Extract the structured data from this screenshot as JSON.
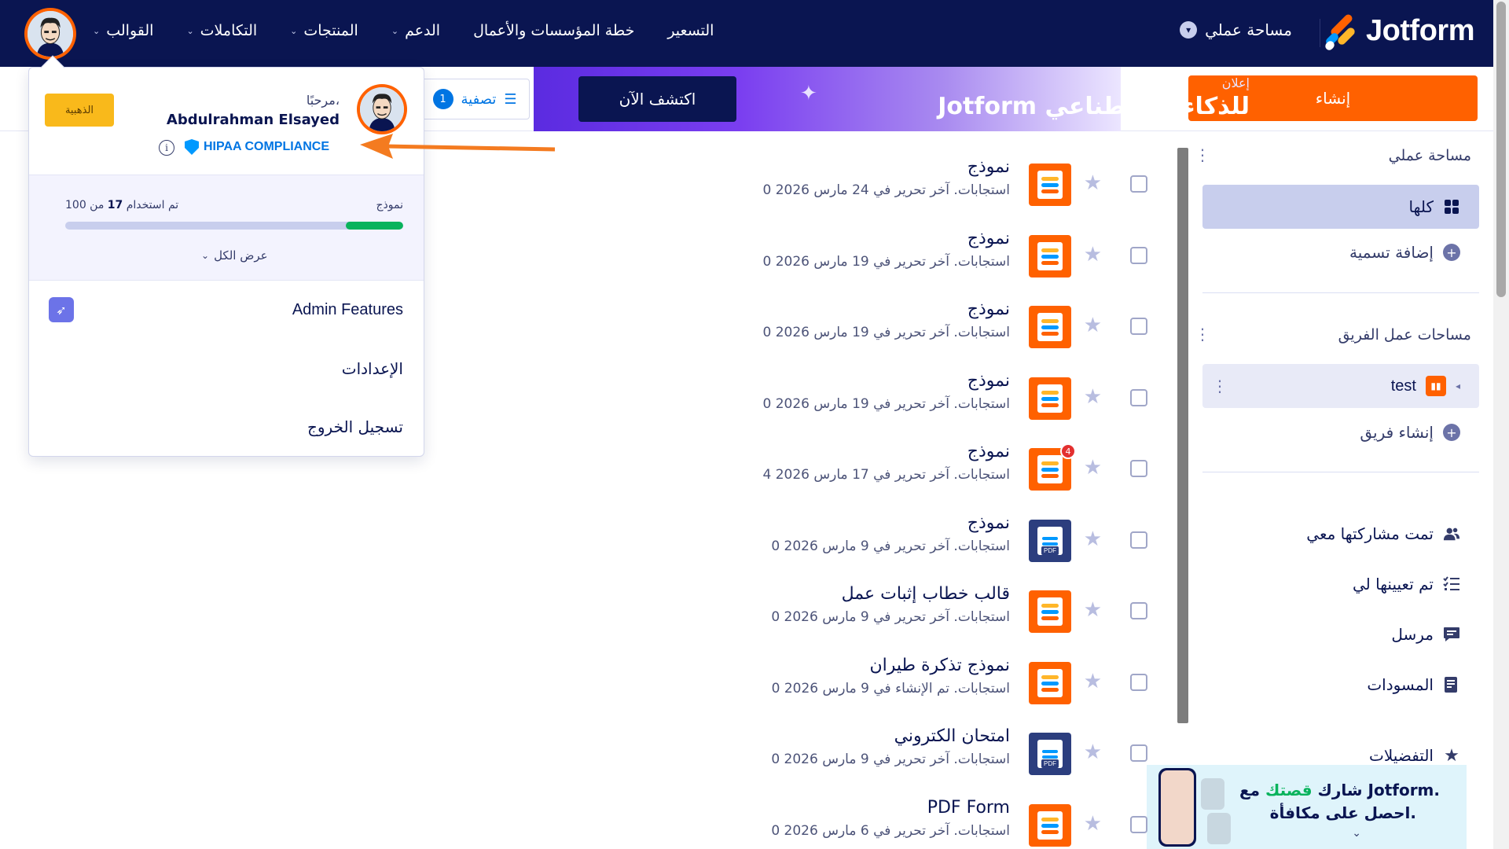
{
  "brand": {
    "name": "Jotform"
  },
  "nav": {
    "workspace": "مساحة عملي",
    "links": [
      {
        "label": "القوالب",
        "dropdown": true
      },
      {
        "label": "التكاملات",
        "dropdown": true
      },
      {
        "label": "المنتجات",
        "dropdown": true
      },
      {
        "label": "الدعم",
        "dropdown": true
      },
      {
        "label": "خطة المؤسسات والأعمال",
        "dropdown": false
      },
      {
        "label": "التسعير",
        "dropdown": false
      }
    ]
  },
  "toolbar": {
    "create_label": "إنشاء",
    "ad_label": "إعلان",
    "ad_title": "Jotform للذكاء الاصطناعي",
    "discover_label": "اكتشف الآن",
    "filter_label": "تصفية",
    "filter_count": "1"
  },
  "sidebar": {
    "my_workspace_title": "مساحة عملي",
    "all_label": "كلها",
    "add_label": "إضافة تسمية",
    "team_title": "مساحات عمل الفريق",
    "team_name": "test",
    "create_team": "إنشاء فريق",
    "shared": "تمت مشاركتها معي",
    "assigned": "تم تعيينها لي",
    "sent": "مرسل",
    "drafts": "المسودات",
    "favorites": "التفضيلات",
    "promo_line1_a": "شارك ",
    "promo_line1_hl": "قصتك",
    "promo_line1_b": " مع Jotform.",
    "promo_line2": "احصل على مكافأة."
  },
  "forms": [
    {
      "title": "نموذج",
      "meta": "0 استجابات. آخر تحرير في 24 مارس 2026",
      "icon": "form",
      "badge": ""
    },
    {
      "title": "نموذج",
      "meta": "0 استجابات. آخر تحرير في 19 مارس 2026",
      "icon": "form",
      "badge": ""
    },
    {
      "title": "نموذج",
      "meta": "0 استجابات. آخر تحرير في 19 مارس 2026",
      "icon": "form",
      "badge": ""
    },
    {
      "title": "نموذج",
      "meta": "0 استجابات. آخر تحرير في 19 مارس 2026",
      "icon": "form",
      "badge": ""
    },
    {
      "title": "نموذج",
      "meta": "4 استجابات. آخر تحرير في 17 مارس 2026",
      "icon": "form",
      "badge": "4"
    },
    {
      "title": "نموذج",
      "meta": "0 استجابات. آخر تحرير في 9 مارس 2026",
      "icon": "pdf",
      "badge": ""
    },
    {
      "title": "قالب خطاب إثبات عمل",
      "meta": "0 استجابات. آخر تحرير في 9 مارس 2026",
      "icon": "form",
      "badge": ""
    },
    {
      "title": "نموذج تذكرة طيران",
      "meta": "0 استجابات. تم الإنشاء في 9 مارس 2026",
      "icon": "form",
      "badge": ""
    },
    {
      "title": "امتحان الكتروني",
      "meta": "0 استجابات. آخر تحرير في 9 مارس 2026",
      "icon": "pdf",
      "badge": ""
    },
    {
      "title": "PDF Form",
      "meta": "0 استجابات. آخر تحرير في 6 مارس 2026",
      "icon": "form",
      "badge": ""
    }
  ],
  "account": {
    "greeting": "مرحبًا،",
    "name": "Abdulrahman Elsayed",
    "plan": "الذهبية",
    "hipaa": "HIPAA COMPLIANCE",
    "usage_label": "نموذج",
    "usage_prefix": "تم استخدام",
    "usage_used": "17",
    "usage_suffix": "من 100",
    "usage_fraction": 0.17,
    "view_all": "عرض الكل",
    "admin": "Admin Features",
    "settings": "الإعدادات",
    "logout": "تسجيل الخروج"
  },
  "colors": {
    "navy": "#0a1551",
    "orange": "#ff6100",
    "blue": "#0075e3",
    "green": "#09b35c",
    "gold": "#f9b91b"
  }
}
